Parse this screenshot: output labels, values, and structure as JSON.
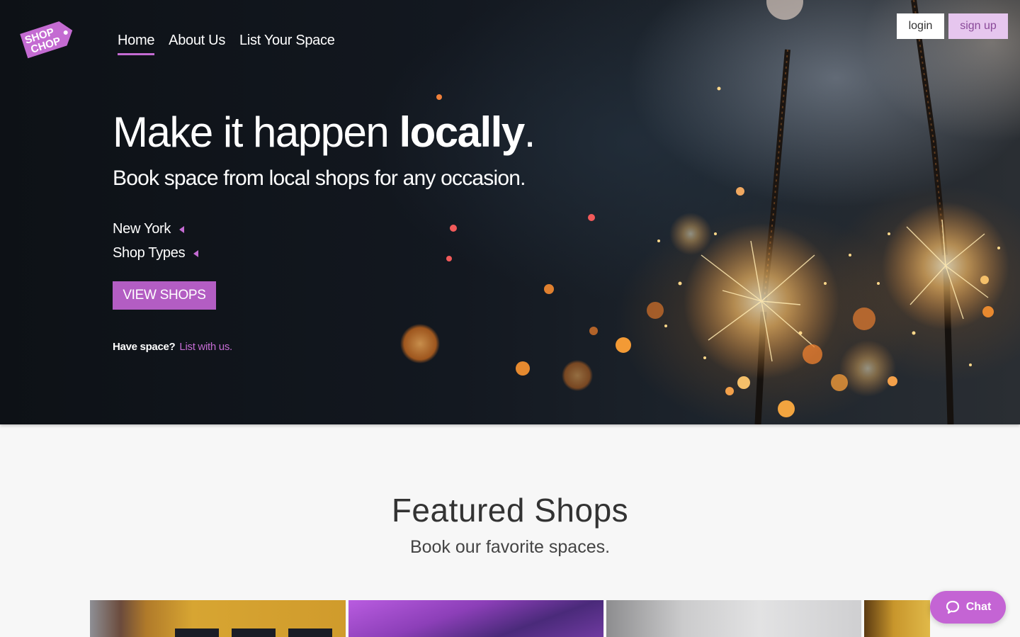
{
  "brand": {
    "logo_line1": "SHOP",
    "logo_line2": "CHOP",
    "accent": "#c46bd2",
    "button": "#b35dc3"
  },
  "nav": {
    "items": [
      "Home",
      "About Us",
      "List Your Space"
    ],
    "active": "Home"
  },
  "auth": {
    "login": "login",
    "signup": "sign up"
  },
  "hero": {
    "headline_regular": "Make it happen ",
    "headline_bold": "locally",
    "headline_end": ".",
    "subhead": "Book space from local shops for any occasion.",
    "location_select": "New York",
    "type_select": "Shop Types",
    "cta": "VIEW SHOPS",
    "have_space": "Have space?",
    "list_link": "List with us."
  },
  "featured": {
    "title": "Featured Shops",
    "subtitle": "Book our favorite spaces."
  },
  "chat": {
    "label": "Chat",
    "icon": "chat-bubble-icon"
  }
}
